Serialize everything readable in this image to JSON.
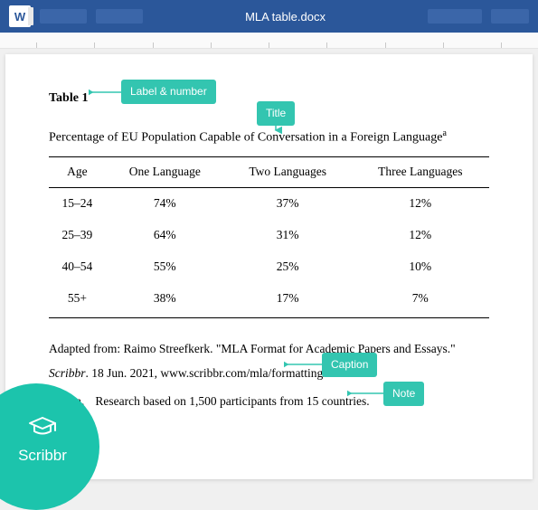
{
  "app": {
    "icon_letter": "W",
    "filename": "MLA table.docx"
  },
  "document": {
    "table_label": "Table 1",
    "title": "Percentage of EU Population Capable of Conversation in a Foreign Language",
    "title_footnote_marker": "a",
    "columns": [
      "Age",
      "One Language",
      "Two Languages",
      "Three Languages"
    ],
    "rows": [
      {
        "age": "15–24",
        "one": "74%",
        "two": "37%",
        "three": "12%"
      },
      {
        "age": "25–39",
        "one": "64%",
        "two": "31%",
        "three": "12%"
      },
      {
        "age": "40–54",
        "one": "55%",
        "two": "25%",
        "three": "10%"
      },
      {
        "age": "55+",
        "one": "38%",
        "two": "17%",
        "three": "7%"
      }
    ],
    "caption_prefix": "Adapted from: Raimo Streefkerk. \"MLA Format for Academic Papers and Essays.\" ",
    "caption_italic": "Scribbr",
    "caption_suffix": ". 18 Jun. 2021, www.scribbr.com/mla/formatting/.",
    "note_marker": "a.",
    "note_text": "Research based on 1,500 participants from 15 countries."
  },
  "annotations": {
    "label_number": "Label & number",
    "title": "Title",
    "caption": "Caption",
    "note": "Note"
  },
  "brand": {
    "name": "Scribbr"
  },
  "chart_data": {
    "type": "table",
    "title": "Percentage of EU Population Capable of Conversation in a Foreign Language",
    "columns": [
      "Age",
      "One Language",
      "Two Languages",
      "Three Languages"
    ],
    "rows": [
      [
        "15–24",
        74,
        37,
        12
      ],
      [
        "25–39",
        64,
        31,
        12
      ],
      [
        "40–54",
        55,
        25,
        10
      ],
      [
        "55+",
        38,
        17,
        7
      ]
    ],
    "unit": "percent",
    "source": "Adapted from: Raimo Streefkerk. \"MLA Format for Academic Papers and Essays.\" Scribbr. 18 Jun. 2021, www.scribbr.com/mla/formatting/.",
    "note": "Research based on 1,500 participants from 15 countries."
  }
}
